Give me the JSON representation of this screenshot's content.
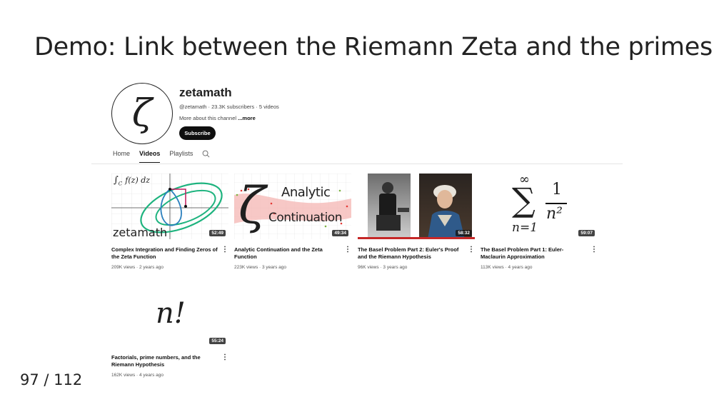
{
  "slide": {
    "title": "Demo: Link between the Riemann Zeta and the primes",
    "page_number": "97 / 112"
  },
  "channel": {
    "avatar_glyph": "ζ",
    "name": "zetamath",
    "meta": "@zetamath · 23.3K subscribers · 5 videos",
    "about": "More about this channel",
    "about_more": "...more",
    "subscribe_label": "Subscribe"
  },
  "tabs": [
    {
      "label": "Home"
    },
    {
      "label": "Videos"
    },
    {
      "label": "Playlists"
    }
  ],
  "videos": [
    {
      "title": "Complex Integration and Finding Zeros of the Zeta Function",
      "views": "209K views · 2 years ago",
      "duration": "52:49",
      "thumb_text": {
        "formula": "∫",
        "sub": "C",
        "body": "f(z) dz",
        "brand": "zetamath"
      }
    },
    {
      "title": "Analytic Continuation and the Zeta Function",
      "views": "223K views · 3 years ago",
      "duration": "49:34",
      "thumb_text": {
        "glyph": "ζ",
        "line1": "Analytic",
        "line2": "Continuation"
      }
    },
    {
      "title": "The Basel Problem Part 2: Euler's Proof and the Riemann Hypothesis",
      "views": "96K views · 3 years ago",
      "duration": "58:32"
    },
    {
      "title": "The Basel Problem Part 1: Euler-Maclaurin Approximation",
      "views": "113K views · 4 years ago",
      "duration": "59:07",
      "thumb_text": {
        "upper": "∞",
        "sigma": "∑",
        "lower": "n=1",
        "num": "1",
        "den": "n²"
      }
    },
    {
      "title": "Factorials, prime numbers, and the Riemann Hypothesis",
      "views": "162K views · 4 years ago",
      "duration": "55:24",
      "thumb_text": {
        "formula": "n!"
      }
    }
  ],
  "colors": {
    "accent_green": "#1db37e",
    "accent_blue": "#2a7fbd",
    "accent_pink": "#c2185b",
    "band_pink": "#f4b5b3"
  }
}
